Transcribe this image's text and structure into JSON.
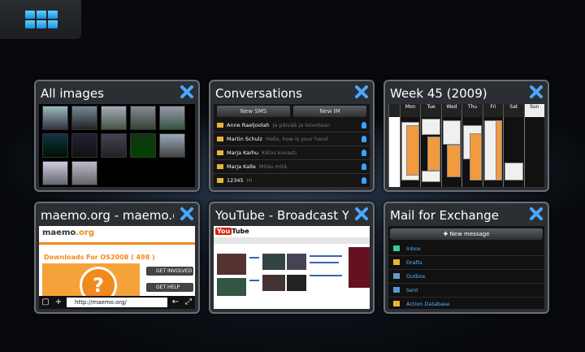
{
  "colors": {
    "accent": "#2a9df4",
    "close": "#4aa8ff",
    "background": "#07090c",
    "card_border": "#6b6f75"
  },
  "switcher": {
    "icon": "app-grid-icon"
  },
  "cards": [
    {
      "title": "All images"
    },
    {
      "title": "Conversations",
      "new_sms": "New SMS",
      "new_im": "New IM",
      "rows": [
        {
          "name": "Anne Raeljoolah",
          "meta": "Ja päivää ja toivotaan"
        },
        {
          "name": "Martin Schulz",
          "meta": "Hello, how is your hand"
        },
        {
          "name": "Marja Karhu",
          "meta": "Kiitos kovasti"
        },
        {
          "name": "Marja Kalle",
          "meta": "Mitäs mitä"
        },
        {
          "name": "12345",
          "meta": "Hi"
        }
      ]
    },
    {
      "title": "Week 45 (2009)",
      "days": [
        "Mon",
        "Tue",
        "Wed",
        "Thu",
        "Fri",
        "Sat",
        "Sun"
      ]
    },
    {
      "title": "maemo.org - maemo.org",
      "logo_text": "maemo",
      "logo_suffix": ".org",
      "heading": "Downloads For OS2008 ( 498 )",
      "btn1": "GET INVOLVED",
      "btn2": "GET HELP",
      "url": "http://maemo.org/"
    },
    {
      "title": "YouTube - Broadcast Yourself",
      "logo": "You",
      "logo_tube": "Tube"
    },
    {
      "title": "Mail for Exchange",
      "new_message": "New message",
      "folders": [
        {
          "label": "Inbox",
          "count": ""
        },
        {
          "label": "Drafts",
          "count": ""
        },
        {
          "label": "Outbox",
          "count": ""
        },
        {
          "label": "Sent",
          "count": ""
        },
        {
          "label": "Action Database",
          "count": ""
        }
      ]
    }
  ]
}
